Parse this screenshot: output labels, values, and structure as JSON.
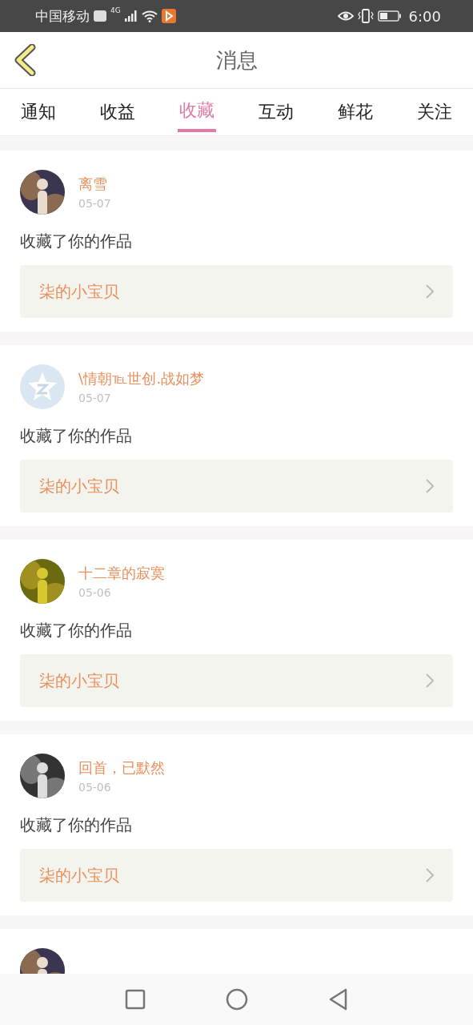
{
  "status_bar": {
    "carrier": "中国移动",
    "network": "4G",
    "time": "6:00"
  },
  "header": {
    "title": "消息"
  },
  "tabs": [
    {
      "label": "通知",
      "selected": false
    },
    {
      "label": "收益",
      "selected": false
    },
    {
      "label": "收藏",
      "selected": true
    },
    {
      "label": "互动",
      "selected": false
    },
    {
      "label": "鲜花",
      "selected": false
    },
    {
      "label": "关注",
      "selected": false
    }
  ],
  "messages": [
    {
      "avatar": {
        "kind": "picture"
      },
      "name": "离雪",
      "date": "05-07",
      "text": "收藏了你的作品",
      "work": "柒的小宝贝"
    },
    {
      "avatar": {
        "kind": "default"
      },
      "name": "\\情朝℡世创.战如梦",
      "date": "05-07",
      "text": "收藏了你的作品",
      "work": "柒的小宝贝"
    },
    {
      "avatar": {
        "kind": "picture"
      },
      "name": "十二章的寂寞",
      "date": "05-06",
      "text": "收藏了你的作品",
      "work": "柒的小宝贝"
    },
    {
      "avatar": {
        "kind": "picture"
      },
      "name": "回首，已默然",
      "date": "05-06",
      "text": "收藏了你的作品",
      "work": "柒的小宝贝"
    },
    {
      "avatar": {
        "kind": "picture"
      }
    }
  ]
}
